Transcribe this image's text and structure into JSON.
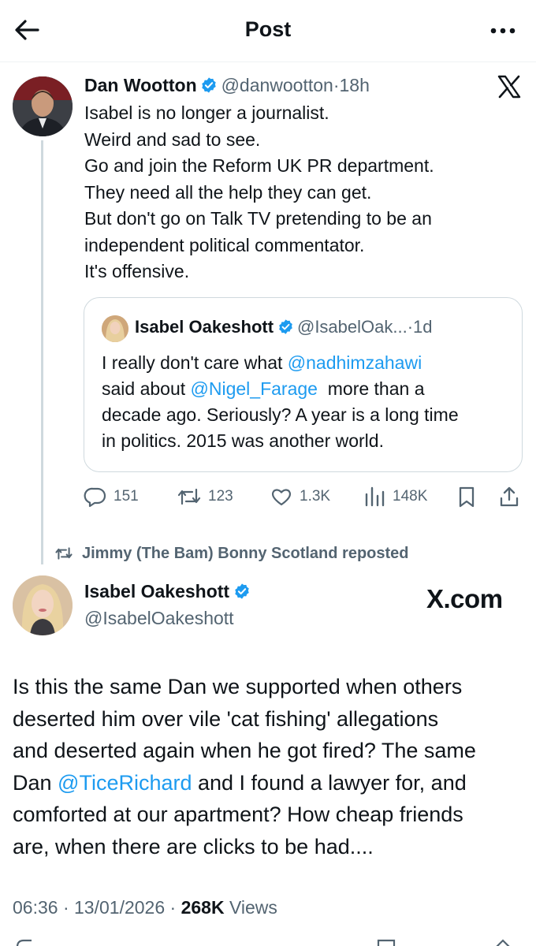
{
  "header": {
    "title": "Post"
  },
  "tweet1": {
    "name": "Dan Wootton",
    "handle": "@danwootton",
    "separator": "·",
    "time": "18h",
    "lines": [
      "Isabel is no longer a journalist.",
      "Weird and sad to see.",
      "Go and join the Reform UK PR department.",
      "They need all the help they can get.",
      "But don't go on Talk TV pretending to be an",
      "independent political commentator.",
      "It's offensive."
    ],
    "quote": {
      "name": "Isabel Oakeshott",
      "handle": "@IsabelOak...",
      "separator": "·",
      "time": "1d",
      "line1_a": "I really don't care what ",
      "line1_mention": "@nadhimzahawi",
      "line2_a": "said about ",
      "line2_mention": "@Nigel_Farage",
      "line2_b": "  more than a",
      "line3": "decade ago. Seriously? A year is a long time",
      "line4": "in politics. 2015 was another world."
    },
    "actions": {
      "replies": "151",
      "reposts": "123",
      "likes": "1.3K",
      "views": "148K"
    }
  },
  "repost_banner": "Jimmy (The Bam) Bonny Scotland reposted",
  "tweet2": {
    "name": "Isabel Oakeshott",
    "handle": "@IsabelOakeshott",
    "watermark": "X.com",
    "line1": "Is this the same Dan we supported when others",
    "line2": "deserted him over vile 'cat fishing' allegations",
    "line3": "and deserted again when he got fired? The same",
    "line4_a": "Dan ",
    "line4_mention": "@TiceRichard",
    "line4_b": " and I found a lawyer for, and",
    "line5": "comforted at our apartment? How cheap friends",
    "line6": "are, when there are clicks to be had....",
    "meta": {
      "time": "06:36",
      "sep1": " · ",
      "date": "13/01/2026",
      "sep2": " · ",
      "views_count": "268K",
      "views_label": " Views"
    }
  },
  "colors": {
    "text": "#0f1419",
    "secondary": "#536471",
    "link": "#1d9bf0",
    "verified": "#1d9bf0",
    "border": "#cfd9de"
  },
  "icons": {
    "back": "arrow-left-icon",
    "more": "more-horizontal-icon",
    "verified": "verified-badge-icon",
    "logo": "x-logo-icon",
    "reply": "reply-icon",
    "repost": "repost-icon",
    "like": "heart-icon",
    "views": "views-icon",
    "bookmark": "bookmark-icon",
    "share": "share-icon"
  }
}
